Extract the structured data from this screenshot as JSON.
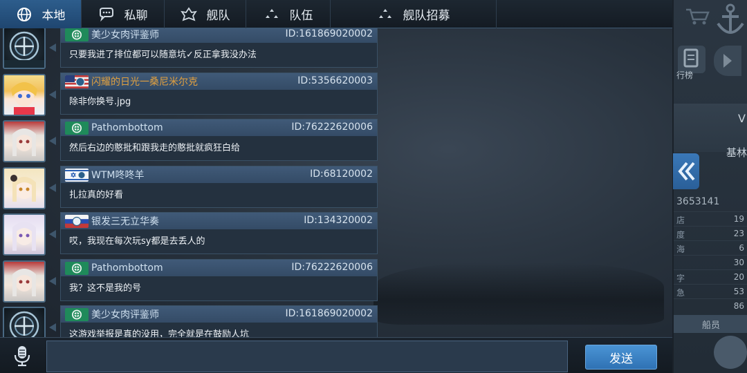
{
  "tabs": [
    {
      "label": "本地",
      "icon": "globe-icon",
      "active": true
    },
    {
      "label": "私聊",
      "icon": "chat-bubble-icon",
      "active": false
    },
    {
      "label": "舰队",
      "icon": "fleet-emblem-icon",
      "active": false
    },
    {
      "label": "队伍",
      "icon": "team-icon",
      "active": false
    },
    {
      "label": "舰队招募",
      "icon": "recruit-icon",
      "active": false
    }
  ],
  "messages": [
    {
      "name": "美少女肉评鉴师",
      "id": "ID:161869020002",
      "text": "只要我进了排位都可以随意坑✓反正拿我没办法",
      "flag": "badge-flag",
      "name_color": "#cfe0ef",
      "avatar": "crest-avatar"
    },
    {
      "name": "闪耀的日光一桑尼米尔克",
      "id": "ID:5356620003",
      "text": "除非你换号.jpg",
      "flag": "usa-flag",
      "name_color": "#e0a040",
      "avatar": "anime-girl-blonde-avatar"
    },
    {
      "name": "Pathombottom",
      "id": "ID:76222620006",
      "text": "然后右边的憨批和跟我走的憨批就疯狂白给",
      "flag": "badge-flag",
      "name_color": "#cfe0ef",
      "avatar": "anime-girl-silver-avatar"
    },
    {
      "name": "WTM咚咚羊",
      "id": "ID:68120002",
      "text": "扎拉真的好看",
      "flag": "israel-flag",
      "name_color": "#cfe0ef",
      "avatar": "anime-girl-cream-avatar"
    },
    {
      "name": "银发三无立华奏",
      "id": "ID:134320002",
      "text": "哎，我现在每次玩sy都是去丢人的",
      "flag": "russia-flag",
      "name_color": "#cfe0ef",
      "avatar": "anime-girl-white-avatar"
    },
    {
      "name": "Pathombottom",
      "id": "ID:76222620006",
      "text": "我？这不是我的号",
      "flag": "badge-flag",
      "name_color": "#cfe0ef",
      "avatar": "anime-girl-silver-avatar"
    },
    {
      "name": "美少女肉评鉴师",
      "id": "ID:161869020002",
      "text": "这游戏举报是真的没用，完全就是在鼓励人坑",
      "flag": "badge-flag",
      "name_color": "#cfe0ef",
      "avatar": "crest-avatar"
    }
  ],
  "right_panel": {
    "stat_number": "3653141",
    "partial_label_1": "V",
    "partial_label_2": "基林",
    "stats": [
      "19",
      "23",
      "6",
      "30",
      "20",
      "53",
      "86"
    ],
    "stat_keys": [
      "店",
      "度",
      "海",
      "",
      "字",
      "急",
      ""
    ],
    "crew_label": "船员",
    "rank_label": "行榜"
  },
  "input": {
    "value": "",
    "placeholder": ""
  },
  "send_label": "发送",
  "colors": {
    "accent": "#2f72b4",
    "tab_active": "#2d5d8c",
    "bubble_head": "#3a5270",
    "name_gold": "#e0a040"
  }
}
